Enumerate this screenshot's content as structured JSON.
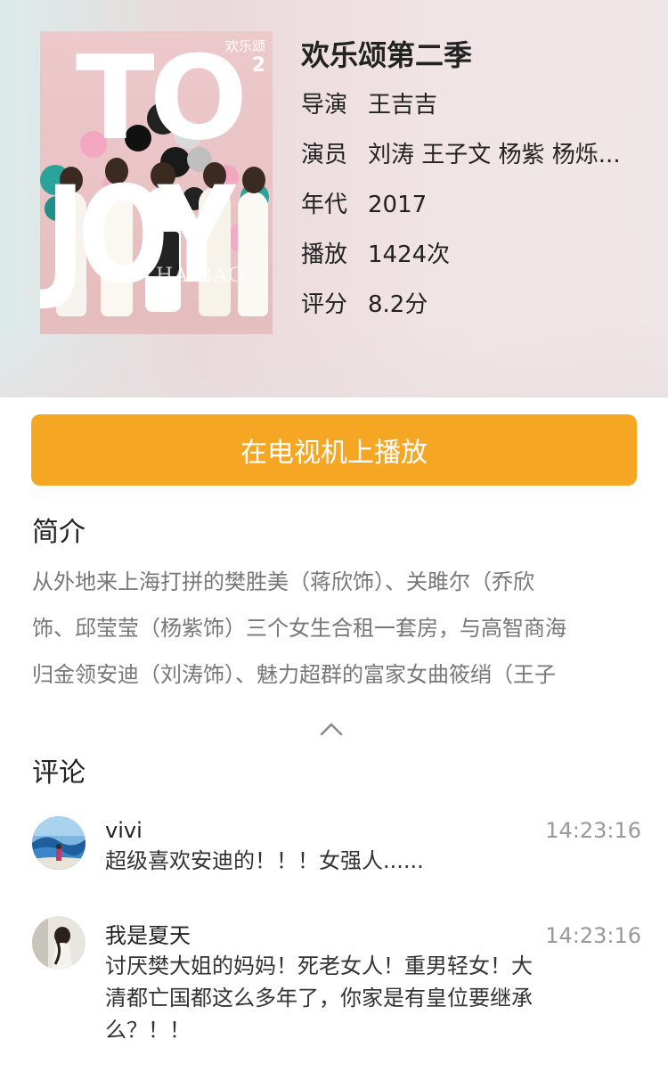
{
  "show": {
    "title": "欢乐颂第二季",
    "poster": {
      "title_en_top": "TO",
      "title_en_bottom": "JOY",
      "brand_cn": "欢乐颂",
      "season_num": "2",
      "watermark": "HAIBAO"
    },
    "fields": [
      {
        "label": "导演",
        "value": "王吉吉"
      },
      {
        "label": "演员",
        "value": "刘涛 王子文 杨紫 杨烁..."
      },
      {
        "label": "年代",
        "value": "2017"
      },
      {
        "label": "播放",
        "value": "1424次"
      },
      {
        "label": "评分",
        "value": "8.2分"
      }
    ]
  },
  "play_button": {
    "label": "在电视机上播放"
  },
  "intro": {
    "heading": "简介",
    "lines": [
      "从外地来上海打拼的樊胜美（蒋欣饰）、关雎尔（乔欣",
      "饰、邱莹莹（杨紫饰）三个女生合租一套房，与高智商海",
      "归金领安迪（刘涛饰）、魅力超群的富家女曲筱绡（王子"
    ],
    "collapse_icon": "chevron-up-icon"
  },
  "comments_section": {
    "heading": "评论",
    "items": [
      {
        "name": "vivi",
        "time": "14:23:16",
        "text": "超级喜欢安迪的！！！女强人......"
      },
      {
        "name": "我是夏天",
        "time": "14:23:16",
        "text": "讨厌樊大姐的妈妈！死老女人！重男轻女！大清都亡国都这么多年了，你家是有皇位要继承么？！！"
      }
    ]
  },
  "colors": {
    "accent": "#f5a623",
    "poster_pink": "#ecc9cb"
  }
}
